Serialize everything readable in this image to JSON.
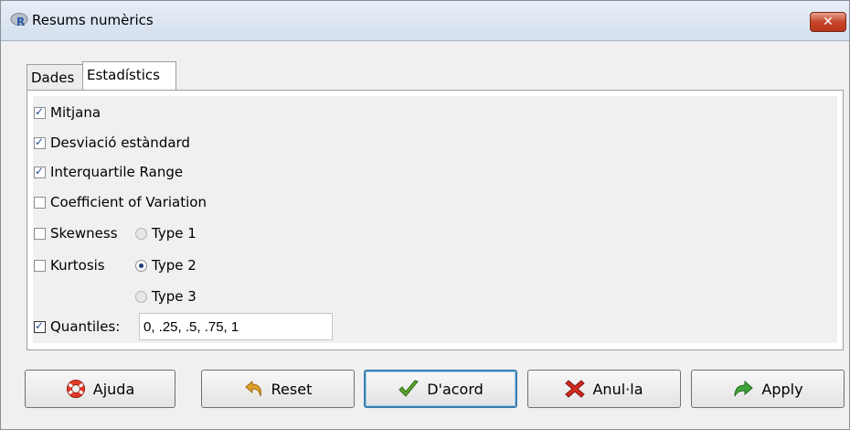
{
  "window": {
    "title": "Resums numèrics",
    "close_label": "✕"
  },
  "tabs": [
    {
      "label": "Dades"
    },
    {
      "label": "Estadístics"
    }
  ],
  "options": [
    {
      "label": "Mitjana",
      "checked": true
    },
    {
      "label": "Desviació estàndard",
      "checked": true
    },
    {
      "label": "Interquartile Range",
      "checked": true
    },
    {
      "label": "Coefficient of Variation",
      "checked": false
    },
    {
      "label": "Skewness",
      "checked": false
    },
    {
      "label": "Kurtosis",
      "checked": false
    }
  ],
  "types": [
    {
      "label": "Type 1",
      "selected": false
    },
    {
      "label": "Type 2",
      "selected": true
    },
    {
      "label": "Type 3",
      "selected": false
    }
  ],
  "quantiles": {
    "label": "Quantiles:",
    "checked": true,
    "value": "0, .25, .5, .75, 1"
  },
  "buttons": {
    "help": "Ajuda",
    "reset": "Reset",
    "ok": "D'acord",
    "cancel": "Anul·la",
    "apply": "Apply"
  },
  "colors": {
    "close": "#c6462a",
    "ok_check": "#5ca62f",
    "cancel_x": "#d42a1f",
    "apply_arrow": "#3fa33a",
    "reset_arrow": "#e0a12a"
  }
}
